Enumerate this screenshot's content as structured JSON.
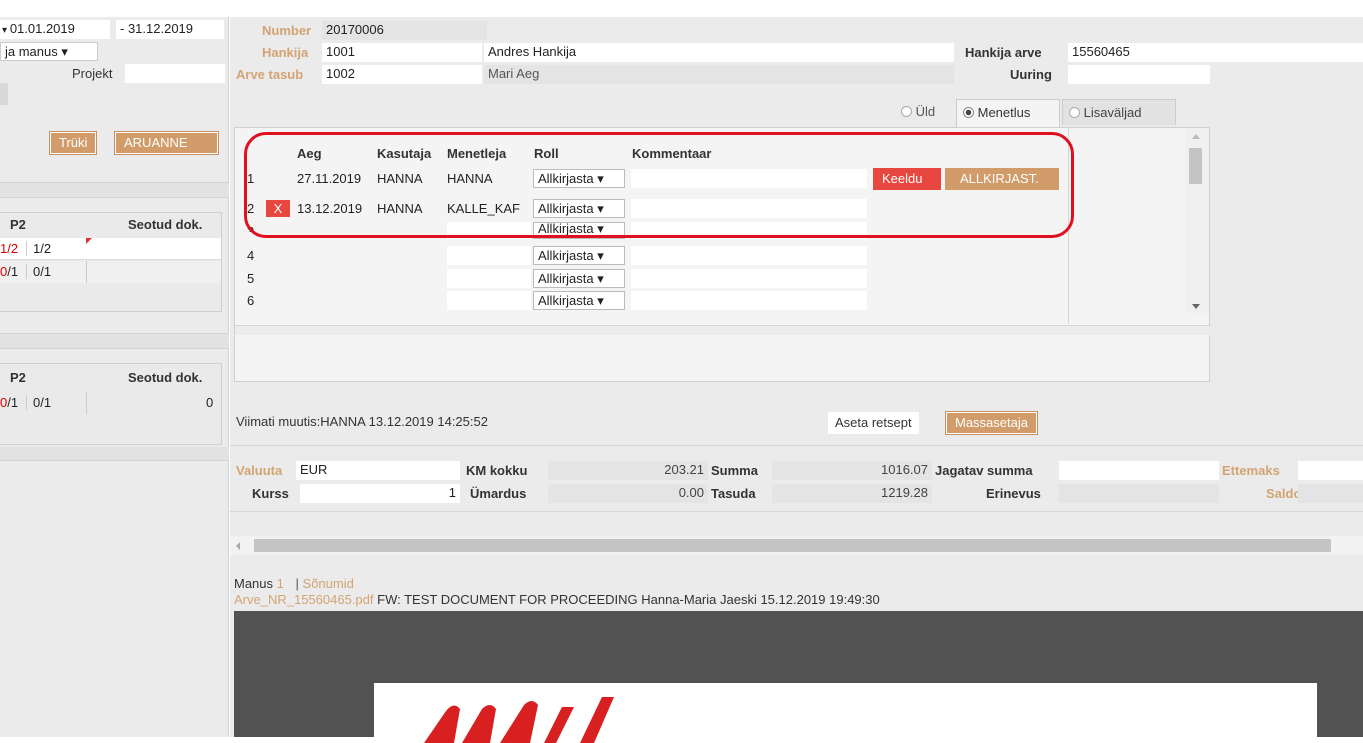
{
  "filters": {
    "date_from": "01.01.2019",
    "date_to": "- 31.12.2019",
    "manus_select": "ja manus ▾",
    "projekt_label": "Projekt",
    "print_button": "Trüki",
    "report_button": "ARUANNE"
  },
  "left_table1": {
    "col_p2": "P2",
    "col_seotud": "Seotud dok.",
    "rows": [
      {
        "a": "1/2",
        "b": "1/2"
      },
      {
        "a": "0/1",
        "b": "0/1"
      }
    ]
  },
  "left_table2": {
    "col_p2": "P2",
    "col_seotud": "Seotud dok.",
    "rows": [
      {
        "a": "0/1",
        "b": "0/1",
        "c": "0"
      }
    ]
  },
  "header": {
    "number_label": "Number",
    "number_value": "20170006",
    "hankija_label": "Hankija",
    "hankija_code": "1001",
    "hankija_name": "Andres Hankija",
    "hankija_arve_label": "Hankija arve",
    "hankija_arve_value": "15560465",
    "arve_tasub_label": "Arve tasub",
    "arve_tasub_code": "1002",
    "arve_tasub_name": "Mari Aeg",
    "uuring_label": "Uuring"
  },
  "tabs": {
    "uld": "Üld",
    "menetlus": "Menetlus",
    "lisavaljad": "Lisaväljad"
  },
  "proc_table": {
    "headers": [
      "Aeg",
      "Kasutaja",
      "Menetleja",
      "Roll",
      "Kommentaar"
    ],
    "rows": [
      {
        "n": "1",
        "aeg": "27.11.2019",
        "kasutaja": "HANNA",
        "menetleja": "HANNA",
        "roll": "Allkirjasta ▾"
      },
      {
        "n": "2",
        "aeg": "13.12.2019",
        "kasutaja": "HANNA",
        "menetleja": "KALLE_KAF",
        "roll": "Allkirjasta ▾"
      },
      {
        "n": "3",
        "aeg": "",
        "kasutaja": "",
        "menetleja": "",
        "roll": "Allkirjasta ▾"
      },
      {
        "n": "4",
        "aeg": "",
        "kasutaja": "",
        "menetleja": "",
        "roll": "Allkirjasta ▾"
      },
      {
        "n": "5",
        "aeg": "",
        "kasutaja": "",
        "menetleja": "",
        "roll": "Allkirjasta ▾"
      },
      {
        "n": "6",
        "aeg": "",
        "kasutaja": "",
        "menetleja": "",
        "roll": "Allkirjasta ▾"
      }
    ],
    "keeldu_button": "Keeldu",
    "allkirjasta_button": "ALLKIRJAST.",
    "delete_button": "X"
  },
  "footer_info": {
    "last_changed": "Viimati muutis:HANNA 13.12.2019 14:25:52",
    "aseta_retsept": "Aseta retsept",
    "massasetaja": "Massasetaja"
  },
  "totals": {
    "valuuta_label": "Valuuta",
    "valuuta_value": "EUR",
    "km_kokku_label": "KM kokku",
    "km_kokku_value": "203.21",
    "summa_label": "Summa",
    "summa_value": "1016.07",
    "jagatav_label": "Jagatav summa",
    "ettemaks_label": "Ettemaks",
    "kurss_label": "Kurss",
    "kurss_value": "1",
    "umardus_label": "Ümardus",
    "umardus_value": "0.00",
    "tasuda_label": "Tasuda",
    "tasuda_value": "1219.28",
    "erinevus_label": "Erinevus",
    "saldo_label": "Saldo"
  },
  "attachments": {
    "manus_label": "Manus",
    "manus_count": "1",
    "separator": "|",
    "sonumid": "Sõnumid",
    "file_name": "Arve_NR_15560465.pdf",
    "file_desc": "FW: TEST DOCUMENT FOR PROCEEDING Hanna-Maria Jaeski 15.12.2019 19:49:30"
  },
  "colors": {
    "accent_tan": "#d19c6a",
    "label_tan": "#d4a373",
    "red_button": "#e8473f",
    "annotation_red": "#e01020",
    "viewer_bg": "#525252"
  }
}
